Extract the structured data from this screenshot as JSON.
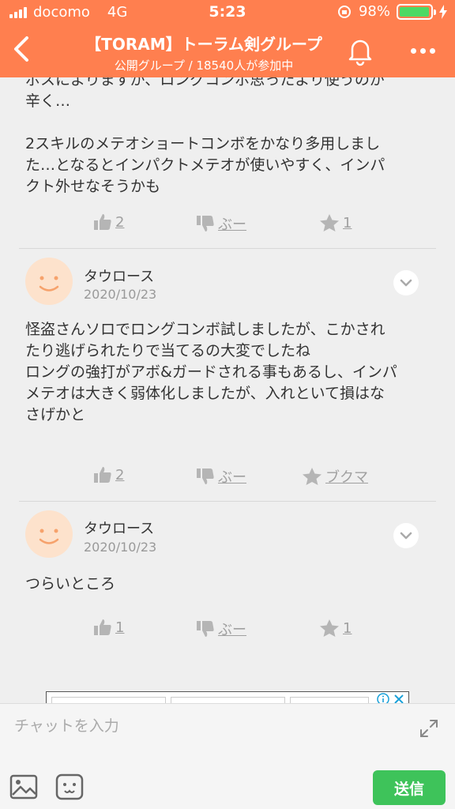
{
  "status_bar": {
    "carrier": "docomo",
    "network": "4G",
    "time": "5:23",
    "battery": "98%",
    "battery_level": 0.98
  },
  "header": {
    "title": "【TORAM】トーラム剣グループ",
    "subtitle": "公開グループ / 18540人が参加中",
    "back_icon": "chevron-left-icon",
    "bell_icon": "bell-icon",
    "more_icon": "more-dots-icon"
  },
  "posts": [
    {
      "text": "ボスによりますが、ロングコンボ思ったより使うのが\n辛く…\n\n2スキルのメテオショートコンボをかなり多用しまし\nた…となるとインパクトメテオが使いやすく、インパ\nクト外せなそうかも",
      "likes": "2",
      "boo": "ぶー",
      "stars": "1"
    },
    {
      "user": "タウロース",
      "date": "2020/10/23",
      "text": "怪盗さんソロでロングコンボ試しましたが、こかされ\nたり逃げられたりで当てるの大変でしたね\nロングの強打がアボ&ガードされる事もあるし、インパ\nメテオは大きく弱体化しましたが、入れといて損はな\nさげかと",
      "likes": "2",
      "boo": "ぶー",
      "stars": "ブクマ"
    },
    {
      "user": "タウロース",
      "date": "2020/10/23",
      "text": "つらいところ",
      "likes": "1",
      "boo": "ぶー",
      "stars": "1"
    }
  ],
  "input_bar": {
    "placeholder": "チャットを入力",
    "send_label": "送信"
  },
  "colors": {
    "header": "#ff7f4f",
    "send": "#3ec35a",
    "reaction": "#a0a0a0"
  }
}
